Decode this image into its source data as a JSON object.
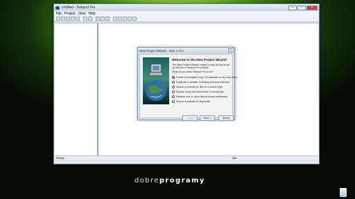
{
  "window": {
    "title": "Untitled - Teleport Pro",
    "menu": [
      "File",
      "Project",
      "View",
      "Help"
    ],
    "status_left": "Ready",
    "status_right": "Idle"
  },
  "dialog": {
    "title": "New Project Wizard - Step 1 of 4",
    "heading": "Welcome to the New Project Wizard!",
    "intro": "The New Project Wizard makes it easy for you to set up and run a Teleport Pro project.",
    "question": "What do you want Teleport Pro to do?",
    "options": [
      "Create a browsable copy of a website on my hard drive",
      "Duplicate a website, including directory structure",
      "Search a website for files of a certain type",
      "Explore every site linked from a central site",
      "Retrieve one or more files at known addresses",
      "Search a website for keywords"
    ],
    "back": "< Back",
    "next": "Next >",
    "cancel": "Anuluj"
  },
  "brand": {
    "light": "dobre",
    "bold": "programy"
  }
}
